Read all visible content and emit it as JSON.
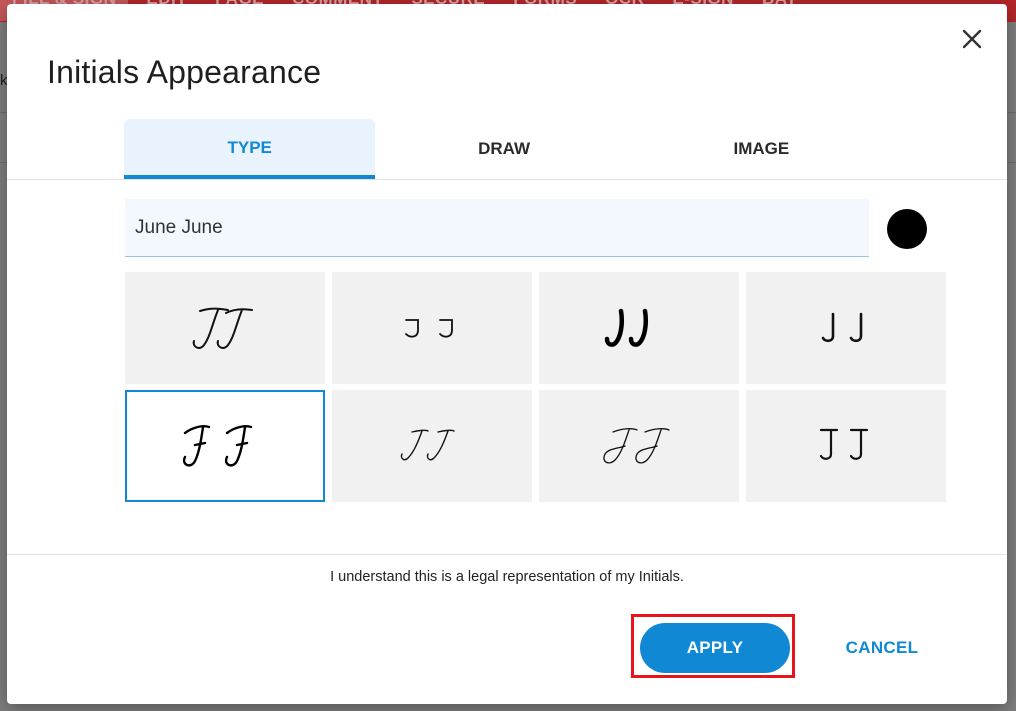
{
  "background": {
    "menu_tabs": [
      "FILL & SIGN",
      "EDIT",
      "PAGE",
      "COMMENT",
      "SECURE",
      "FORMS",
      "OCR",
      "E-SIGN",
      "BAT"
    ],
    "side_letter": "k"
  },
  "dialog": {
    "title": "Initials Appearance",
    "close_icon": "close-icon",
    "tabs": [
      {
        "label": "TYPE",
        "active": true
      },
      {
        "label": "DRAW",
        "active": false
      },
      {
        "label": "IMAGE",
        "active": false
      }
    ],
    "name_input": {
      "value": "June June",
      "placeholder": ""
    },
    "ink_color": "#000000",
    "styles": [
      {
        "preview": "J J",
        "selected": false
      },
      {
        "preview": "J J",
        "selected": false
      },
      {
        "preview": "J J",
        "selected": false
      },
      {
        "preview": "J J",
        "selected": false
      },
      {
        "preview": "J J",
        "selected": true
      },
      {
        "preview": "J J",
        "selected": false
      },
      {
        "preview": "J J",
        "selected": false
      },
      {
        "preview": "J J",
        "selected": false
      }
    ],
    "legal_text": "I understand this is a legal representation of my Initials.",
    "apply_label": "APPLY",
    "cancel_label": "CANCEL"
  },
  "colors": {
    "accent": "#1188d4",
    "highlight": "#e8141c",
    "toolbar": "#b6262a"
  }
}
